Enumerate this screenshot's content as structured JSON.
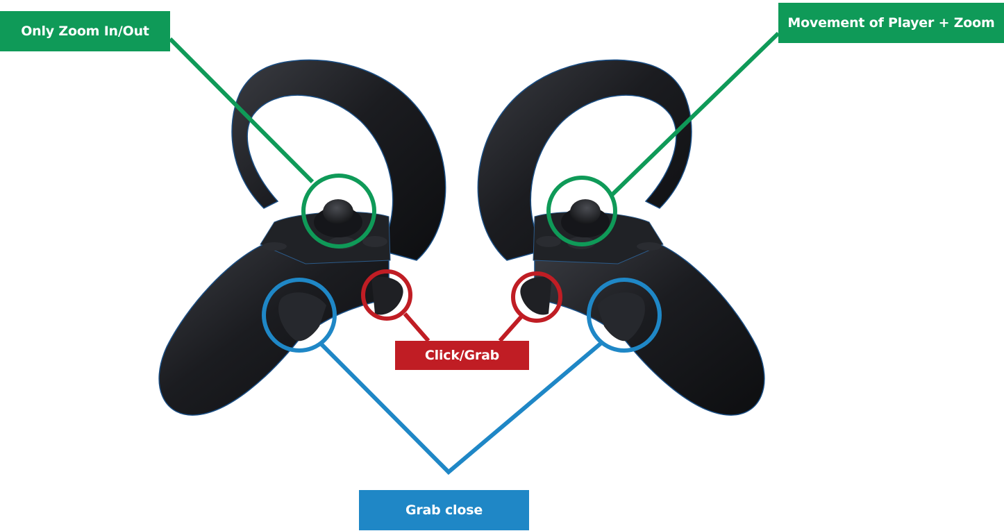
{
  "colors": {
    "zoom_green": "#0f9a58",
    "click_red": "#c01d24",
    "grab_blue": "#1f87c6",
    "controller_body": "#1c1d21"
  },
  "labels": {
    "left_thumbstick": "Only Zoom In/Out",
    "right_thumbstick": "Movement of Player + Zoom",
    "trigger": "Click/Grab",
    "grip": "Grab close"
  }
}
